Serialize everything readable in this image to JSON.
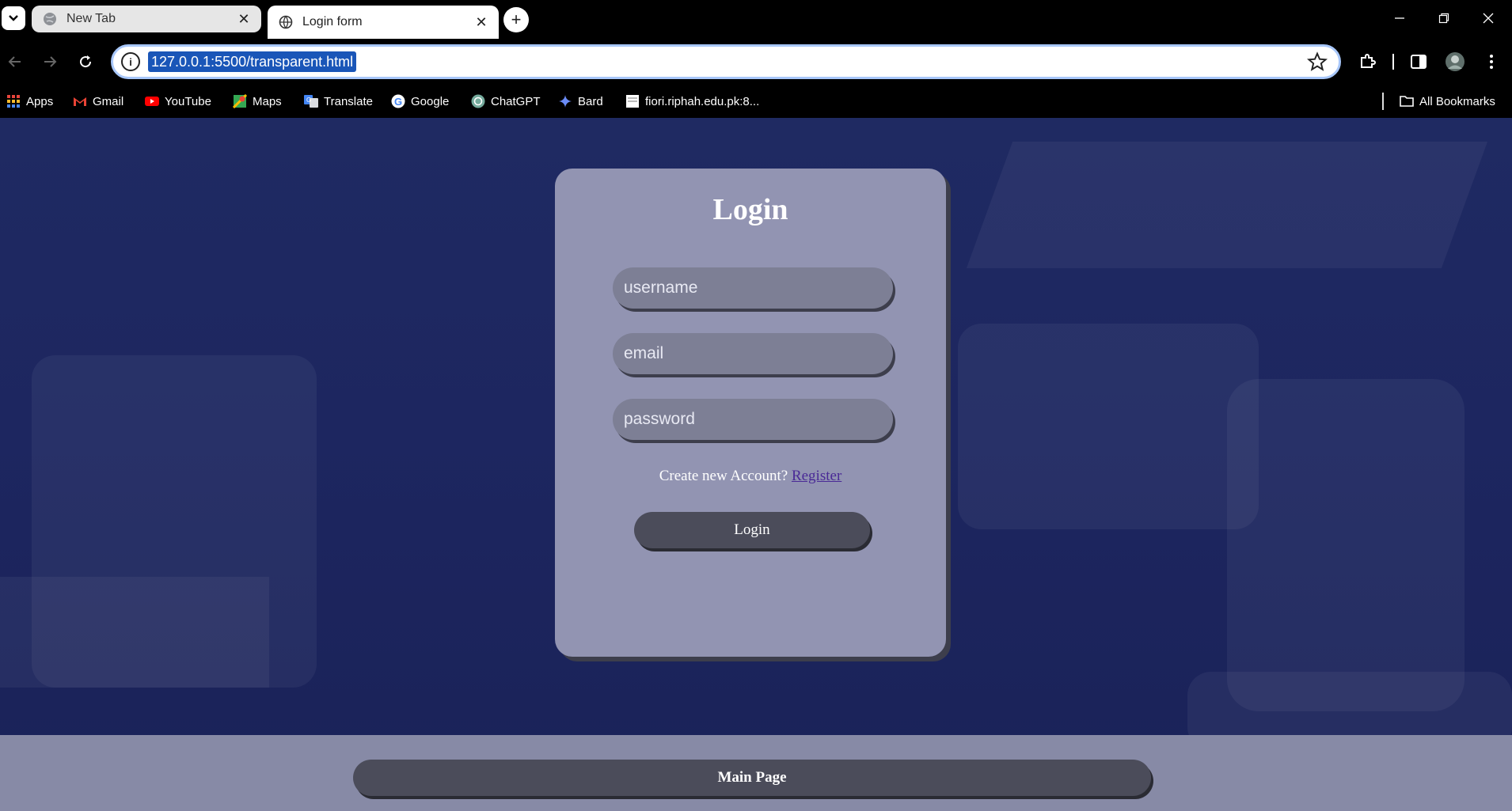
{
  "browser": {
    "tabs": [
      {
        "label": "New Tab",
        "active": false
      },
      {
        "label": "Login form",
        "active": true
      }
    ],
    "address": "127.0.0.1:5500/transparent.html",
    "bookmarks": [
      {
        "label": "Apps",
        "icon": "apps-grid-icon"
      },
      {
        "label": "Gmail",
        "icon": "gmail-icon"
      },
      {
        "label": "YouTube",
        "icon": "youtube-icon"
      },
      {
        "label": "Maps",
        "icon": "maps-icon"
      },
      {
        "label": "Translate",
        "icon": "translate-icon"
      },
      {
        "label": "Google",
        "icon": "google-icon"
      },
      {
        "label": "ChatGPT",
        "icon": "chatgpt-icon"
      },
      {
        "label": "Bard",
        "icon": "bard-icon"
      },
      {
        "label": "fiori.riphah.edu.pk:8...",
        "icon": "page-icon"
      }
    ],
    "all_bookmarks": "All Bookmarks"
  },
  "login": {
    "title": "Login",
    "username_placeholder": "username",
    "email_placeholder": "email",
    "password_placeholder": "password",
    "create_text": "Create new Account?",
    "register_link": "Register",
    "login_button": "Login"
  },
  "footer": {
    "main_page_button": "Main Page"
  },
  "colors": {
    "page_bg": "#1c2456",
    "card_bg": "#9294b2",
    "button_bg": "#4b4c5a",
    "link": "#4a2a96"
  }
}
